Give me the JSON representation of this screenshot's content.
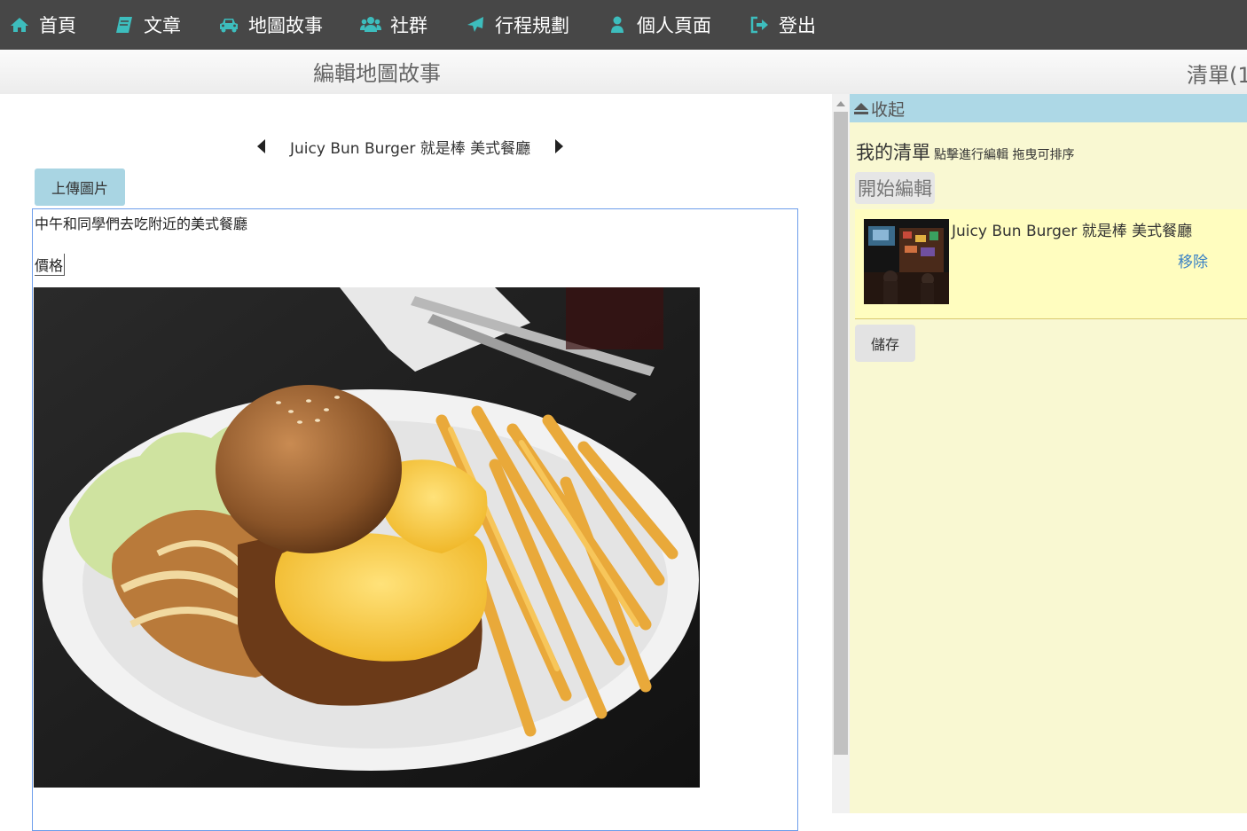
{
  "nav": {
    "items": [
      {
        "label": "首頁",
        "icon": "home-icon"
      },
      {
        "label": "文章",
        "icon": "book-icon"
      },
      {
        "label": "地圖故事",
        "icon": "car-icon"
      },
      {
        "label": "社群",
        "icon": "users-icon"
      },
      {
        "label": "行程規劃",
        "icon": "plane-icon"
      },
      {
        "label": "個人頁面",
        "icon": "user-icon"
      },
      {
        "label": "登出",
        "icon": "sign-out-icon"
      }
    ],
    "icon_color": "#3dbdbd"
  },
  "header": {
    "title": "編輯地圖故事",
    "right_label": "清單(1"
  },
  "editor": {
    "place_title": "Juicy Bun Burger 就是棒 美式餐廳",
    "upload_label": "上傳圖片",
    "content_line1": "中午和同學們去吃附近的美式餐廳",
    "content_line2": "價格"
  },
  "panel": {
    "collapse_label": "收起",
    "list_title": "我的清單",
    "list_hint": "點擊進行編輯 拖曳可排序",
    "edit_label": "開始編輯",
    "items": [
      {
        "name": "Juicy Bun Burger 就是棒 美式餐廳",
        "remove_label": "移除"
      }
    ],
    "save_label": "儲存"
  }
}
